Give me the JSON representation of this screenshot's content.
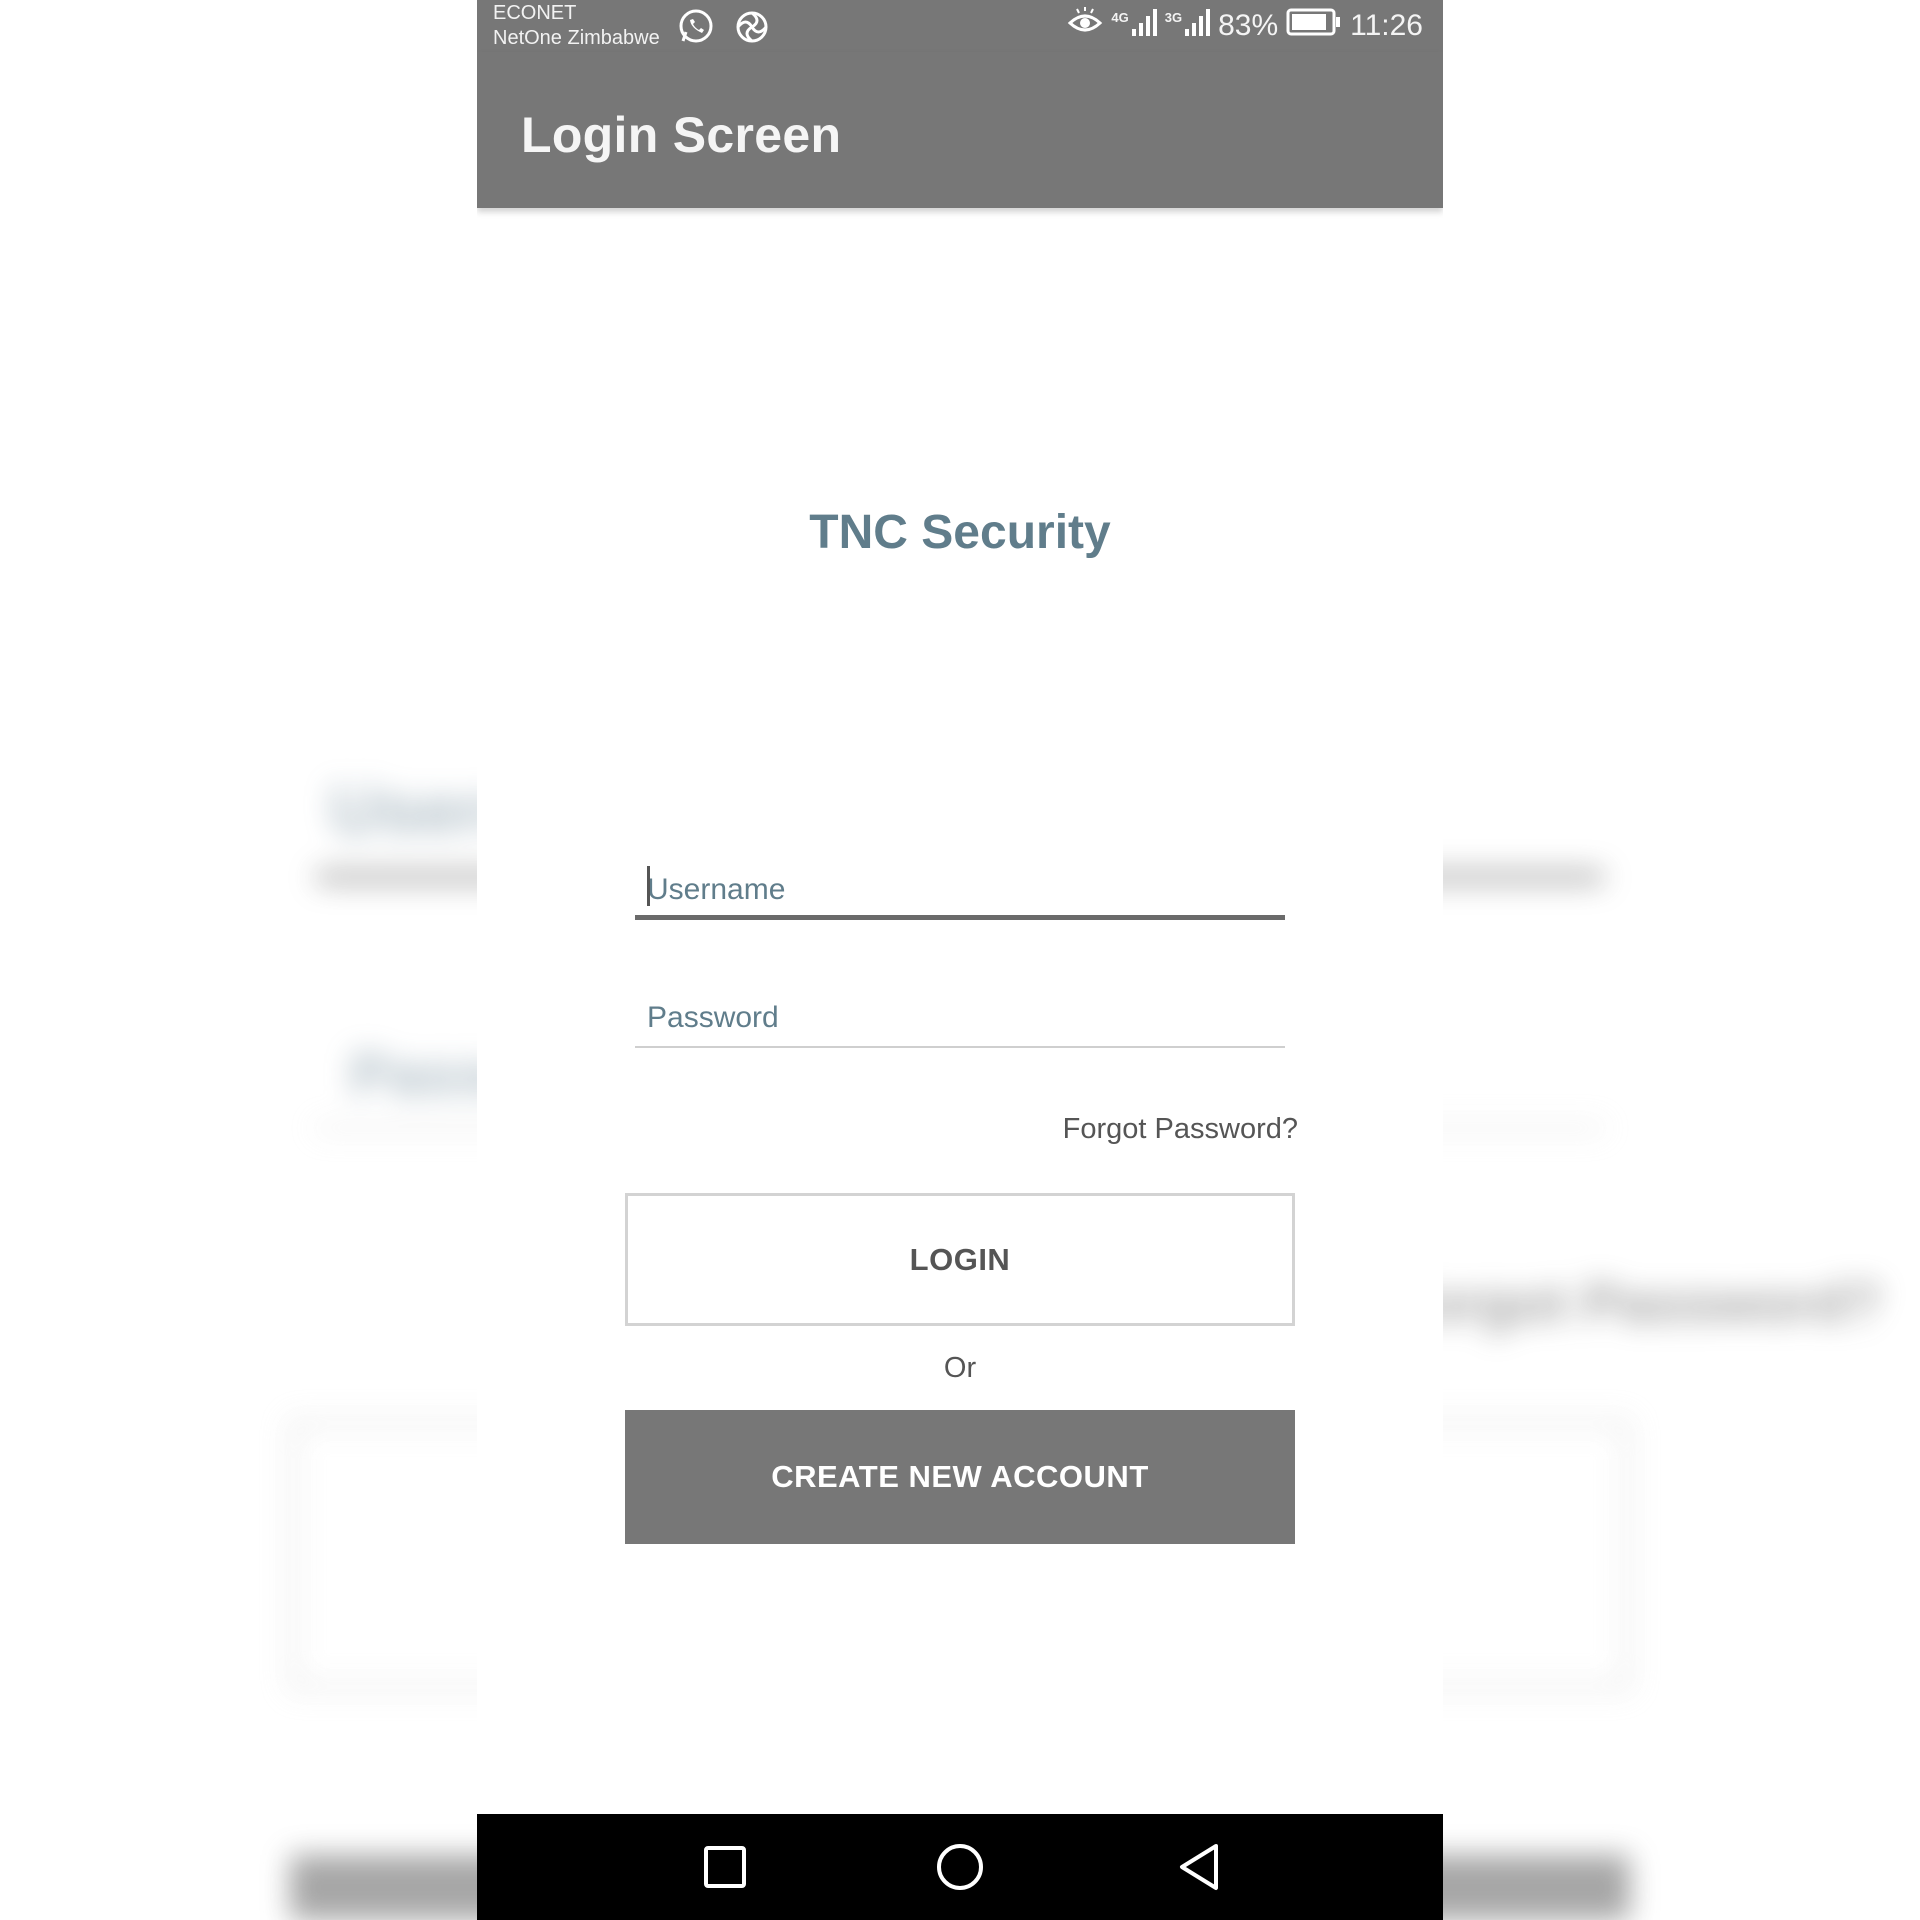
{
  "status_bar": {
    "carrier_primary": "ECONET",
    "carrier_secondary": "NetOne Zimbabwe",
    "network_1": "4G",
    "network_2": "3G",
    "battery": "83%",
    "time": "11:26",
    "icons": [
      "whatsapp-icon",
      "sync-app-icon",
      "eye-icon",
      "signal-icon",
      "signal-icon",
      "battery-icon"
    ]
  },
  "app_bar": {
    "title": "Login Screen"
  },
  "main": {
    "brand_title": "TNC Security",
    "username": {
      "placeholder": "Username",
      "value": ""
    },
    "password": {
      "placeholder": "Password",
      "value": ""
    },
    "forgot_password": "Forgot Password?",
    "login_label": "LOGIN",
    "or_label": "Or",
    "create_account_label": "CREATE NEW ACCOUNT"
  },
  "nav_bar": {
    "icons": [
      "recent-apps-icon",
      "home-icon",
      "back-icon"
    ]
  },
  "colors": {
    "bar_gray": "#777777",
    "title_blue_gray": "#607d8b",
    "text_dark": "#555555",
    "nav_black": "#000000"
  }
}
